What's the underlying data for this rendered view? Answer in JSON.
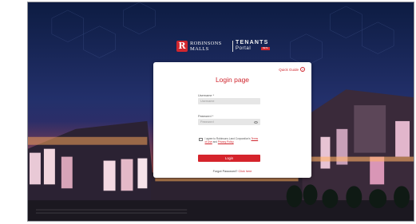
{
  "logo": {
    "brand_line1": "ROBINSONS",
    "brand_line2": "MALLS",
    "tenants": "TENANTS",
    "portal": "Portal",
    "badge": "BETA"
  },
  "login": {
    "title": "Login page",
    "quick_guide": "Quick Guide",
    "username_label": "Username *",
    "username_placeholder": "Username",
    "password_label": "Password *",
    "password_placeholder": "Password",
    "agree_prefix": "I agree to Robinsons Land Corporation's",
    "terms": "Terms of Use",
    "and": "and",
    "privacy": "Privacy Policy",
    "login_button": "Login",
    "forgot_prefix": "Forgot Password?",
    "forgot_link": "Click here"
  },
  "colors": {
    "brand": "#d0262e",
    "sky_top": "#0e2148",
    "sky_mid": "#3a2a6e"
  }
}
